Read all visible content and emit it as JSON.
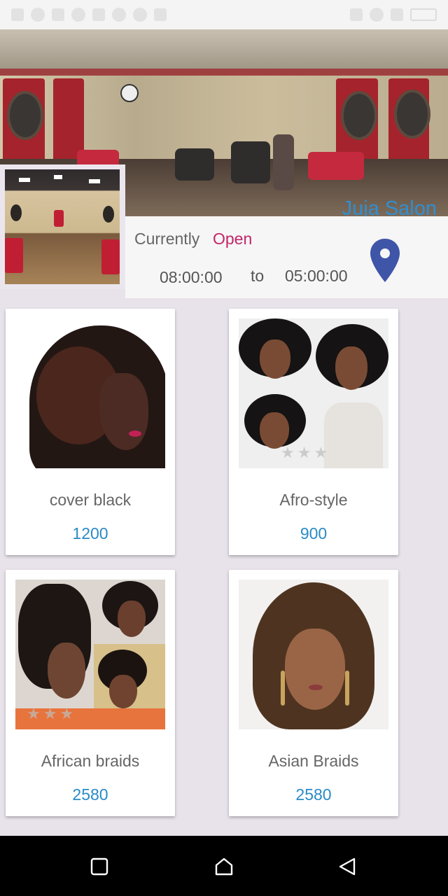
{
  "header": {
    "salon_name": "Juja Salon"
  },
  "status": {
    "label": "Currently",
    "state": "Open",
    "open_time": "08:00:00",
    "separator": "to",
    "close_time": "05:00:00"
  },
  "services": [
    {
      "name": "cover black",
      "price": "1200"
    },
    {
      "name": "Afro-style",
      "price": "900"
    },
    {
      "name": "African braids",
      "price": "2580"
    },
    {
      "name": "Asian Braids",
      "price": "2580"
    }
  ],
  "colors": {
    "accent": "#2a8ac7",
    "open": "#c3256a",
    "pin": "#3e55a8",
    "background": "#e8e2ea"
  },
  "icons": {
    "location": "map-pin-icon",
    "nav_recent": "square-icon",
    "nav_home": "home-icon",
    "nav_back": "triangle-back-icon"
  }
}
